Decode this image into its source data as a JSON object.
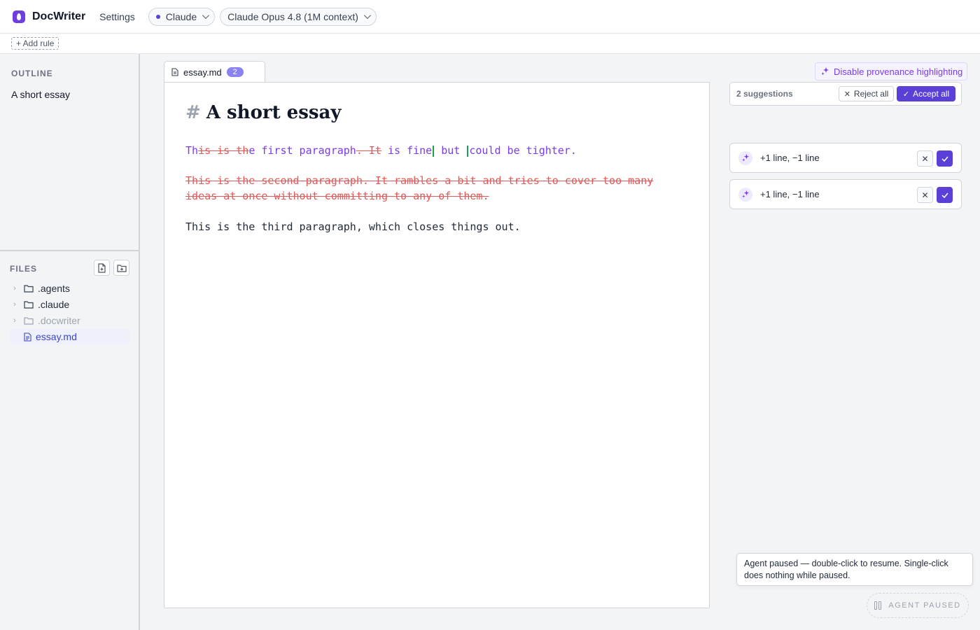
{
  "app": {
    "name": "DocWriter",
    "settings_label": "Settings"
  },
  "toolbar": {
    "provider": "Claude",
    "model": "Claude Opus 4.8 (1M context)",
    "add_rule_label": "+ Add rule"
  },
  "sidebar": {
    "outline_title": "OUTLINE",
    "outline_items": [
      "A short essay"
    ],
    "files_title": "FILES",
    "files": [
      {
        "name": ".agents",
        "type": "folder"
      },
      {
        "name": ".claude",
        "type": "folder"
      },
      {
        "name": ".docwriter",
        "type": "folder",
        "dimmed": true
      },
      {
        "name": "essay.md",
        "type": "file",
        "active": true
      }
    ]
  },
  "editor": {
    "tab_name": "essay.md",
    "tab_badge": "2",
    "heading_hash": "#",
    "heading": "A short essay",
    "p1": {
      "ins1": "Th",
      "del1": "is is th",
      "ins2": "e first paragraph",
      "del2": ". It",
      "ins3": " is fine",
      "ins4": " but ",
      "ins5": "could be tighter."
    },
    "p2_deleted": "This is the second paragraph. It rambles a bit and tries to cover too many ideas at once without committing to any of them.",
    "p3": "This is the third paragraph, which closes things out."
  },
  "review": {
    "provenance_label": "Disable provenance highlighting",
    "suggestions_count_label": "2 suggestions",
    "reject_all_label": "Reject all",
    "accept_all_label": "Accept all",
    "cards": [
      {
        "summary": "+1 line, −1 line"
      },
      {
        "summary": "+1 line, −1 line"
      }
    ]
  },
  "agent": {
    "tooltip": "Agent paused — double-click to resume. Single-click does nothing while paused.",
    "status_label": "AGENT PAUSED"
  },
  "colors": {
    "accent": "#5b3fd6",
    "insert": "#7c3aed",
    "delete": "#e05858"
  }
}
